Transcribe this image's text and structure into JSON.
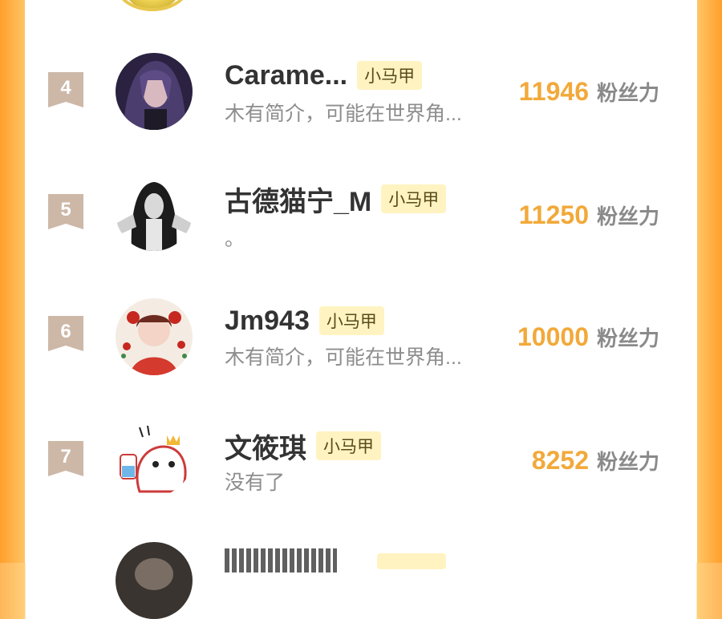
{
  "leaderboard": {
    "entries": [
      {
        "rank": "4",
        "name": "Carame...",
        "badge": "小马甲",
        "bio": "木有简介，可能在世界角...",
        "score": "11946",
        "unit": "粉丝力"
      },
      {
        "rank": "5",
        "name": "古德猫宁_M",
        "badge": "小马甲",
        "bio": "。",
        "score": "11250",
        "unit": "粉丝力"
      },
      {
        "rank": "6",
        "name": "Jm943",
        "badge": "小马甲",
        "bio": "木有简介，可能在世界角...",
        "score": "10000",
        "unit": "粉丝力"
      },
      {
        "rank": "7",
        "name": "文筱琪",
        "badge": "小马甲",
        "bio": "没有了",
        "score": "8252",
        "unit": "粉丝力"
      }
    ]
  },
  "colors": {
    "accent_orange": "#f2a93a",
    "rank_ribbon": "#cdb8a8",
    "badge_bg": "#fff3c2",
    "border_orange": "#ffb65a"
  }
}
